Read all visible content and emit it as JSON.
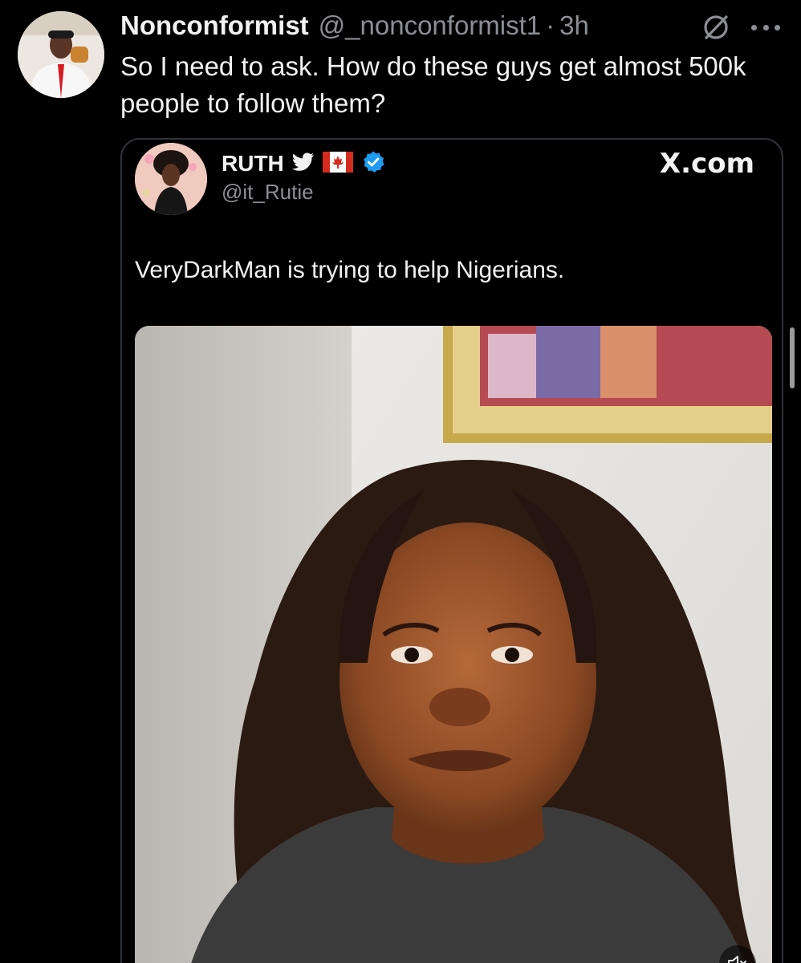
{
  "tweet": {
    "display_name": "Nonconformist",
    "handle": "@_nonconformist1",
    "separator": "·",
    "time": "3h",
    "text": "So I need to ask. How do these guys get almost 500k people to follow them?",
    "avatar_icon": "profile-photo-man-in-white-suit",
    "grok_icon": "grok-icon",
    "more_icon": "more-options-icon"
  },
  "quote": {
    "display_name": "RUTH",
    "name_emojis": [
      "bird-emoji",
      "canada-flag-emoji"
    ],
    "verified": true,
    "verified_color": "#1d9bf0",
    "handle": "@it_Rutie",
    "source": "X.com",
    "text": "VeryDarkMan is trying to help Nigerians.",
    "avatar_icon": "profile-photo-woman",
    "media": {
      "type": "video",
      "description_icon": "video-thumbnail-woman-speaking",
      "muted": true,
      "mute_icon": "volume-muted-icon"
    }
  },
  "colors": {
    "background": "#000000",
    "text_primary": "#f2f2f2",
    "text_secondary": "#8b8f94",
    "border": "#2f3336"
  }
}
